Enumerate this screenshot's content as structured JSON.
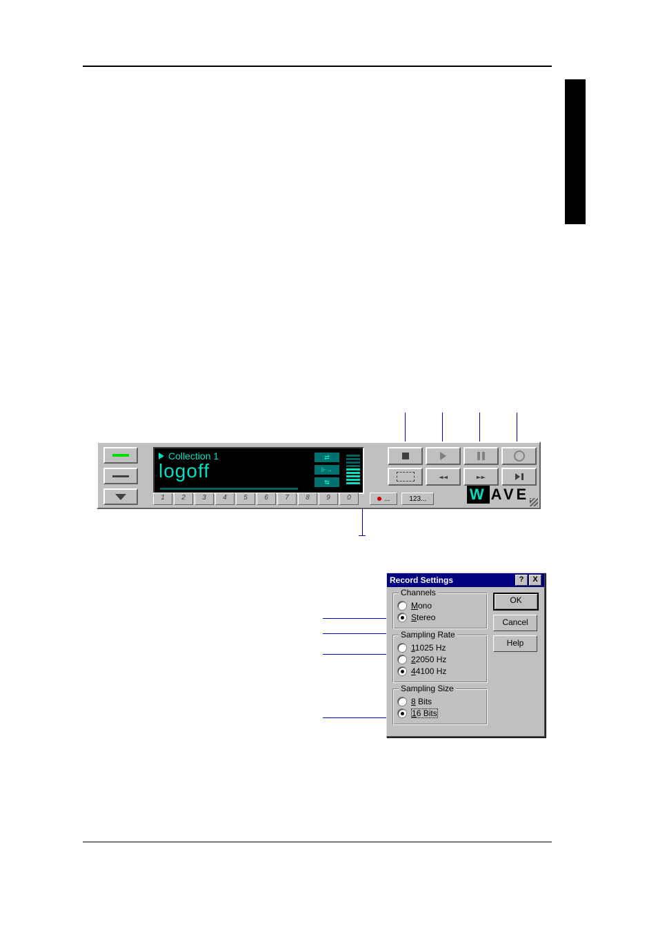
{
  "player": {
    "collection_label": "Collection 1",
    "track_name": "logoff",
    "number_buttons": [
      "1",
      "2",
      "3",
      "4",
      "5",
      "6",
      "7",
      "8",
      "9",
      "0"
    ],
    "extra_record_label": "...",
    "extra_counter_label": "123...",
    "logo_w": "W",
    "logo_rest": "AVE"
  },
  "dialog": {
    "title": "Record Settings",
    "channels_legend": "Channels",
    "mono_label_pre": "M",
    "mono_label_rest": "ono",
    "stereo_label_pre": "S",
    "stereo_label_rest": "tereo",
    "rate_legend": "Sampling Rate",
    "rate1_pre": "1",
    "rate1_rest": "1025 Hz",
    "rate2_pre": "2",
    "rate2_rest": "2050 Hz",
    "rate3_pre": "4",
    "rate3_rest": "4100 Hz",
    "size_legend": "Sampling Size",
    "size8_pre": "8",
    "size8_rest": " Bits",
    "size16_pre": "1",
    "size16_rest": "6 Bits",
    "ok": "OK",
    "cancel": "Cancel",
    "help": "Help",
    "help_glyph": "?",
    "close_glyph": "X"
  }
}
